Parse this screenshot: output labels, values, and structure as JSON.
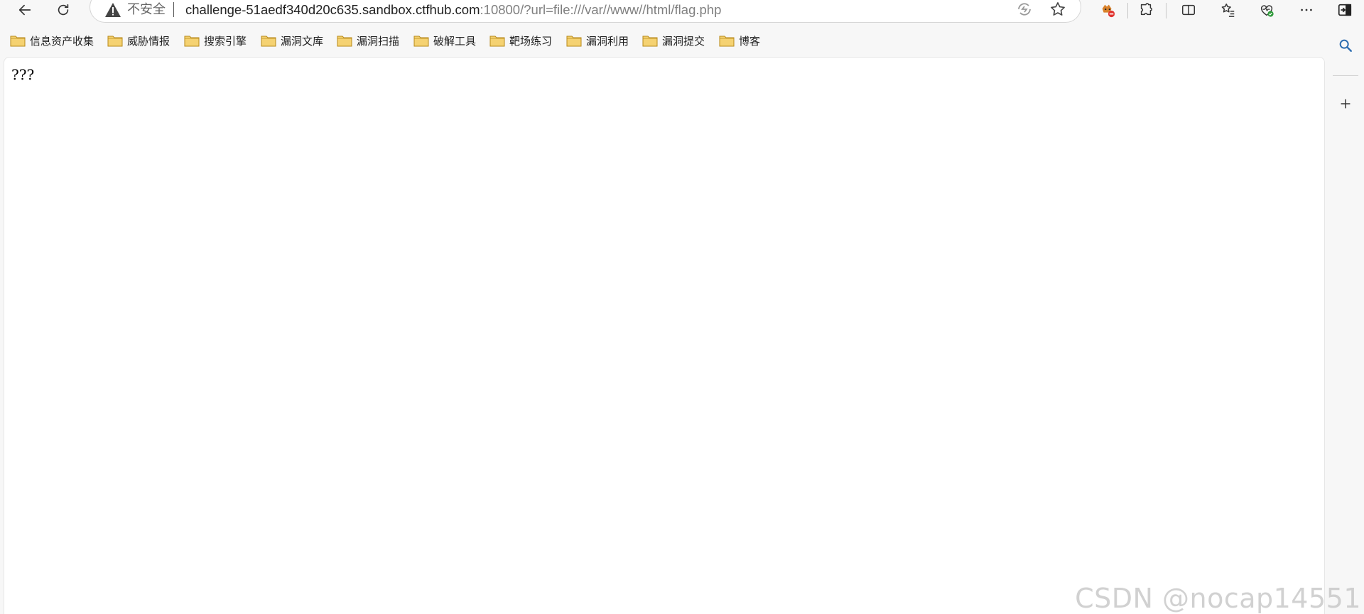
{
  "toolbar": {
    "back_icon": "back-arrow-icon",
    "refresh_icon": "refresh-icon"
  },
  "address_bar": {
    "security_label": "不安全",
    "url_main": "challenge-51aedf340d20c635.sandbox.ctfhub.com",
    "url_rest": ":10800/?url=file:///var//www//html/flag.php"
  },
  "bookmarks": [
    {
      "label": "信息资产收集"
    },
    {
      "label": "威胁情报"
    },
    {
      "label": "搜索引擎"
    },
    {
      "label": "漏洞文库"
    },
    {
      "label": "漏洞扫描"
    },
    {
      "label": "破解工具"
    },
    {
      "label": "靶场练习"
    },
    {
      "label": "漏洞利用"
    },
    {
      "label": "漏洞提交"
    },
    {
      "label": "博客"
    }
  ],
  "page": {
    "body_text": "???"
  },
  "watermark": "CSDN @nocap14551",
  "colors": {
    "folder_fill": "#f5d272",
    "folder_stroke": "#b88a1a",
    "error_badge": "#e0332f",
    "ok_badge": "#2e9a3a"
  }
}
